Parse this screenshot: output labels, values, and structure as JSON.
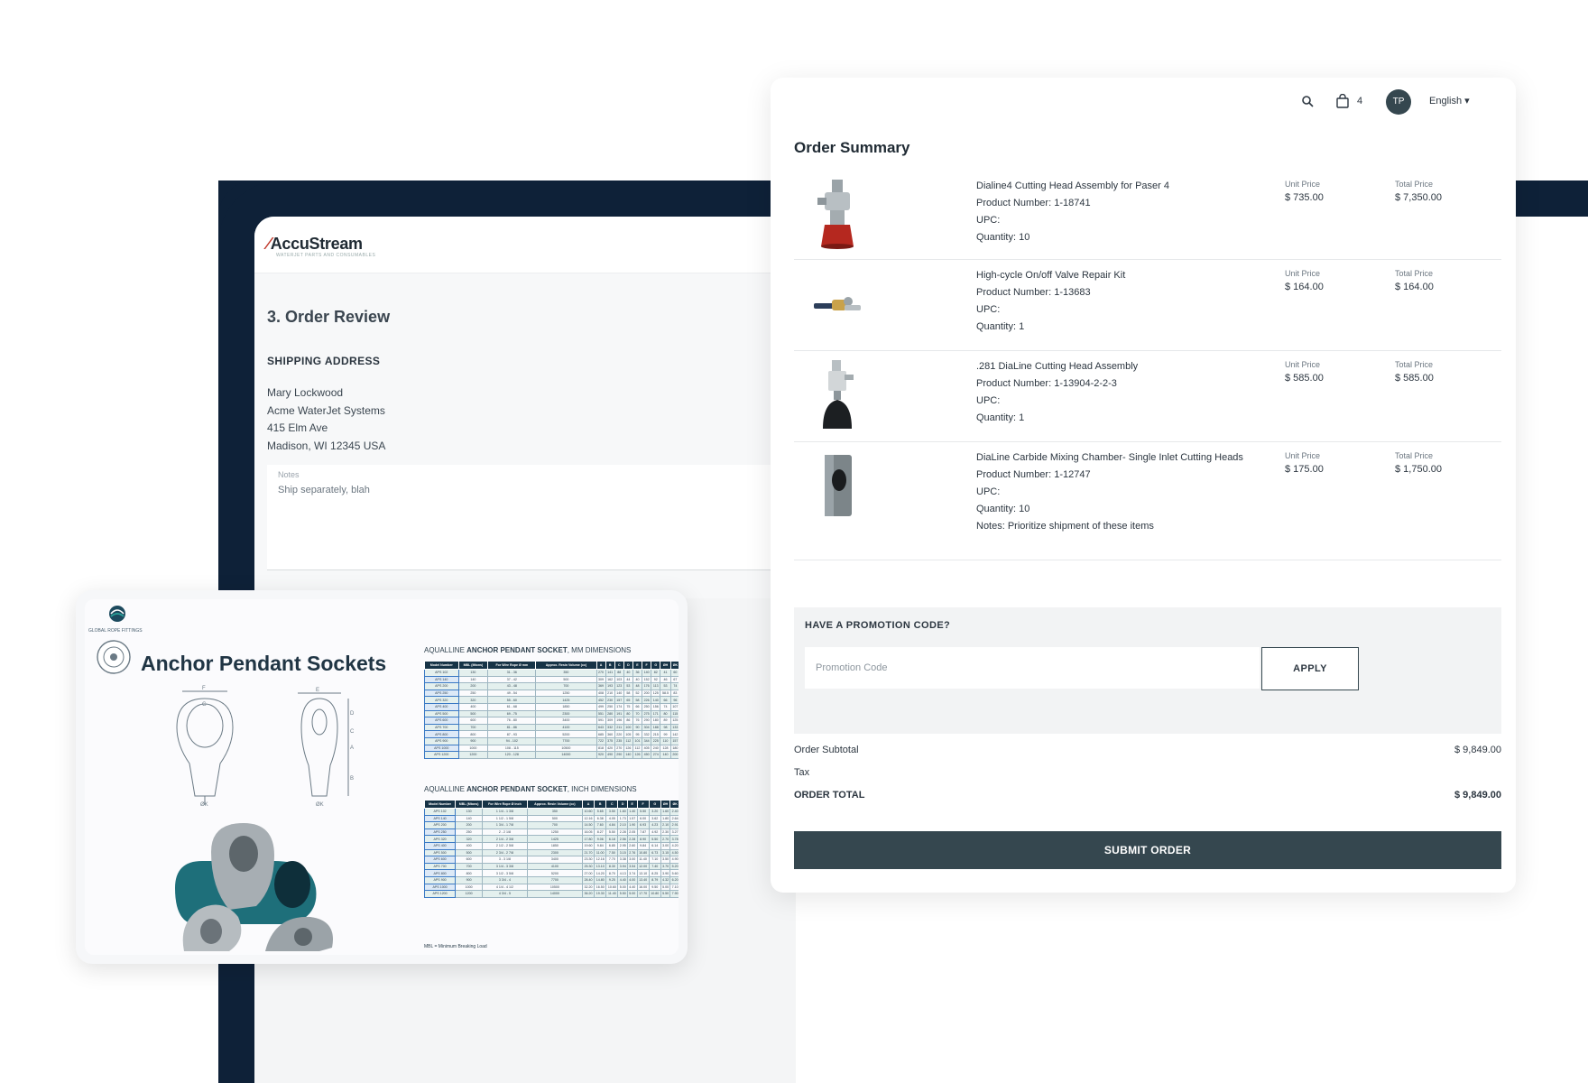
{
  "review": {
    "logo": "AccuStream",
    "logo_tagline": "WATERJET PARTS AND CONSUMABLES",
    "step_title": "3. Order Review",
    "shipping_label": "SHIPPING ADDRESS",
    "address": [
      "Mary Lockwood",
      "Acme WaterJet Systems",
      "415 Elm Ave",
      "Madison, WI 12345 USA"
    ],
    "notes_label": "Notes",
    "notes_value": "Ship separately, blah"
  },
  "topbar": {
    "search_icon": "search-icon",
    "cart_icon": "cart-icon",
    "cart_count": "4",
    "avatar_initials": "TP",
    "language": "English ▾"
  },
  "summary": {
    "title": "Order Summary",
    "unit_price_label": "Unit Price",
    "total_price_label": "Total Price",
    "items": [
      {
        "name": "Dialine4 Cutting Head Assembly for Paser 4",
        "product_number": "Product Number: 1-18741",
        "upc": "UPC:",
        "quantity": "Quantity: 10",
        "unit_price": "$ 735.00",
        "total_price": "$ 7,350.00"
      },
      {
        "name": "High-cycle On/off Valve Repair Kit",
        "product_number": "Product Number: 1-13683",
        "upc": "UPC:",
        "quantity": "Quantity: 1",
        "unit_price": "$ 164.00",
        "total_price": "$ 164.00"
      },
      {
        "name": ".281 DiaLine Cutting Head Assembly",
        "product_number": "Product Number: 1-13904-2-2-3",
        "upc": "UPC:",
        "quantity": "Quantity: 1",
        "unit_price": "$ 585.00",
        "total_price": "$ 585.00"
      },
      {
        "name": "DiaLine Carbide Mixing Chamber- Single Inlet Cutting Heads",
        "product_number": "Product Number: 1-12747",
        "upc": "UPC:",
        "quantity": "Quantity: 10",
        "notes": "Notes: Prioritize shipment of these items",
        "unit_price": "$ 175.00",
        "total_price": "$ 1,750.00"
      }
    ],
    "promo_label": "HAVE A PROMOTION CODE?",
    "promo_placeholder": "Promotion Code",
    "apply_label": "APPLY",
    "subtotal_label": "Order Subtotal",
    "subtotal_value": "$ 9,849.00",
    "tax_label": "Tax",
    "total_label": "ORDER TOTAL",
    "total_value": "$ 9,849.00",
    "submit_label": "SUBMIT ORDER"
  },
  "anchor": {
    "brand": "GLOBAL ROPE FITTINGS",
    "title": "Anchor Pendant Sockets",
    "mm_caption_pre": "AQUALLINE ",
    "mm_caption_bold": "ANCHOR PENDANT SOCKET",
    "mm_caption_post": ", MM DIMENSIONS",
    "inch_caption_pre": "AQUALLINE ",
    "inch_caption_bold": "ANCHOR PENDANT SOCKET",
    "inch_caption_post": ", INCH DIMENSIONS",
    "footnote": "MBL = Minimum Breaking Load",
    "mm_header": [
      "Model Number",
      "MBL (Mtons)",
      "For Wire Rope Ø mm",
      "Approx. Resin Volume (cc)",
      "A",
      "B",
      "C",
      "D",
      "E",
      "F",
      "G",
      "ØH",
      "ØK"
    ],
    "mm_rows": [
      [
        "APS 102",
        "130",
        "31 - 36",
        "350",
        "270",
        "141",
        "88",
        "40",
        "36",
        "140",
        "82",
        "41",
        "60"
      ],
      [
        "APS 140",
        "140",
        "37 - 42",
        "500",
        "309",
        "162",
        "103",
        "44",
        "40",
        "152",
        "92",
        "46",
        "67"
      ],
      [
        "APS 200",
        "200",
        "43 - 48",
        "700",
        "369",
        "193",
        "123",
        "53",
        "48",
        "176",
        "113",
        "53",
        "74"
      ],
      [
        "APS 250",
        "250",
        "49 - 54",
        "1250",
        "408",
        "210",
        "140",
        "58",
        "52",
        "200",
        "125",
        "58.5",
        "83"
      ],
      [
        "APS 320",
        "320",
        "55 - 60",
        "1425",
        "452",
        "230",
        "157",
        "65",
        "58",
        "226",
        "140",
        "66",
        "96"
      ],
      [
        "APS 400",
        "400",
        "61 - 68",
        "1850",
        "499",
        "250",
        "174",
        "75",
        "66",
        "250",
        "156",
        "74",
        "107"
      ],
      [
        "APS 500",
        "500",
        "69 - 75",
        "2300",
        "551",
        "280",
        "191",
        "80",
        "70",
        "275",
        "171",
        "80",
        "115"
      ],
      [
        "APS 600",
        "600",
        "76 - 80",
        "3400",
        "591",
        "309",
        "196",
        "86",
        "76",
        "290",
        "180",
        "89",
        "125"
      ],
      [
        "APS 700",
        "700",
        "81 - 86",
        "4100",
        "643",
        "332",
        "211",
        "100",
        "90",
        "304",
        "188",
        "98",
        "133"
      ],
      [
        "APS 800",
        "800",
        "87 - 93",
        "5200",
        "685",
        "360",
        "220",
        "105",
        "95",
        "332",
        "215",
        "99",
        "142"
      ],
      [
        "APS 900",
        "900",
        "94 - 102",
        "7700",
        "722",
        "375",
        "235",
        "112",
        "101",
        "344",
        "225",
        "110",
        "157"
      ],
      [
        "APS 1000",
        "1000",
        "108 - 115",
        "10500",
        "818",
        "420",
        "270",
        "126",
        "112",
        "405",
        "240",
        "128",
        "180"
      ],
      [
        "APS 1200",
        "1200",
        "120 - 128",
        "14000",
        "920",
        "490",
        "290",
        "140",
        "126",
        "450",
        "274",
        "140",
        "200"
      ]
    ],
    "inch_header": [
      "Model Number",
      "MBL (Mtons)",
      "For Wire Rope Ø inch",
      "Approx. Resin Volume (cc)",
      "A",
      "B",
      "C",
      "D",
      "E",
      "F",
      "G",
      "ØH",
      "ØK"
    ],
    "inch_rows": [
      [
        "APS 102",
        "130",
        "1 1/4 - 1 3/8",
        "350",
        "10.60",
        "5.65",
        "3.50",
        "1.60",
        "1.40",
        "5.50",
        "3.20",
        "1.60",
        "2.40"
      ],
      [
        "APS 140",
        "140",
        "1 1/2 - 1 5/8",
        "500",
        "12.16",
        "6.38",
        "4.05",
        "1.73",
        "1.57",
        "6.00",
        "3.62",
        "1.80",
        "2.64"
      ],
      [
        "APS 200",
        "200",
        "1 3/4 - 1 7/8",
        "700",
        "14.50",
        "7.60",
        "4.84",
        "2.10",
        "1.90",
        "6.93",
        "4.23",
        "2.10",
        "2.91"
      ],
      [
        "APS 250",
        "250",
        "2 - 2 1/8",
        "1250",
        "16.05",
        "8.27",
        "5.50",
        "2.28",
        "2.05",
        "7.87",
        "4.92",
        "2.30",
        "3.27"
      ],
      [
        "APS 320",
        "320",
        "2 1/4 - 2 3/8",
        "1425",
        "17.80",
        "9.06",
        "6.18",
        "2.56",
        "2.28",
        "8.90",
        "5.50",
        "2.70",
        "3.78"
      ],
      [
        "APS 400",
        "400",
        "2 1/2 - 2 5/8",
        "1850",
        "19.60",
        "9.84",
        "6.85",
        "2.95",
        "2.60",
        "9.84",
        "6.14",
        "3.00",
        "4.20"
      ],
      [
        "APS 500",
        "500",
        "2 3/4 - 2 7/8",
        "2300",
        "21.70",
        "11.00",
        "7.50",
        "3.15",
        "2.76",
        "10.80",
        "6.73",
        "3.15",
        "4.50"
      ],
      [
        "APS 600",
        "600",
        "3 - 3 1/8",
        "3400",
        "23.30",
        "12.16",
        "7.70",
        "3.38",
        "3.00",
        "11.40",
        "7.10",
        "3.50",
        "4.90"
      ],
      [
        "APS 700",
        "700",
        "3 1/4 - 3 3/8",
        "4100",
        "25.30",
        "13.10",
        "8.30",
        "3.94",
        "3.54",
        "12.00",
        "7.40",
        "3.70",
        "5.20"
      ],
      [
        "APS 800",
        "800",
        "3 1/2 - 3 5/8",
        "5200",
        "27.00",
        "14.20",
        "8.70",
        "4.13",
        "3.74",
        "13.10",
        "8.25",
        "3.90",
        "5.60"
      ],
      [
        "APS 900",
        "900",
        "3 3/4 - 4",
        "7700",
        "28.40",
        "14.80",
        "9.25",
        "4.40",
        "4.00",
        "13.40",
        "8.79",
        "4.32",
        "6.20"
      ],
      [
        "APS 1000",
        "1000",
        "4 1/4 - 4 1/2",
        "10500",
        "32.20",
        "16.50",
        "10.60",
        "5.00",
        "4.40",
        "16.00",
        "9.50",
        "5.00",
        "7.10"
      ],
      [
        "APS 1200",
        "1200",
        "4 3/4 - 5",
        "14000",
        "36.20",
        "19.30",
        "11.40",
        "5.50",
        "5.00",
        "17.70",
        "10.80",
        "5.50",
        "7.90"
      ]
    ]
  },
  "colors": {
    "navy": "#0e2138",
    "button_dark": "#35474f",
    "accent_red": "#c0392b"
  }
}
